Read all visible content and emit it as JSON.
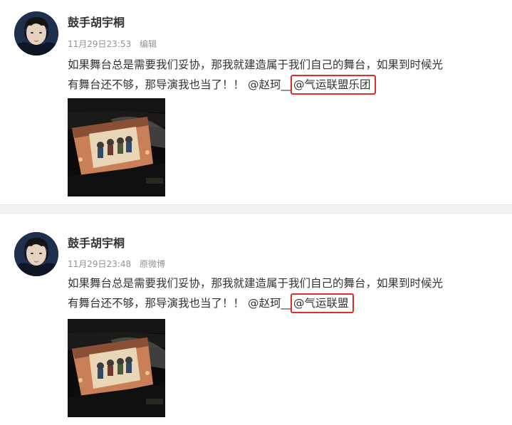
{
  "posts": [
    {
      "author": "鼓手胡宇桐",
      "timestamp": "11月29日23:53",
      "source": "编辑",
      "content": {
        "line1": "如果舞台总是需要我们妥协，那我就建造属于我们自己的舞台，如果到时候光",
        "line2": "有舞台还不够，那导演我也当了！！",
        "mention1": "@赵珂__",
        "mention2": "@气运联盟乐团"
      }
    },
    {
      "author": "鼓手胡宇桐",
      "timestamp": "11月29日23:48",
      "source": "原微博",
      "content": {
        "line1": "如果舞台总是需要我们妥协，那我就建造属于我们自己的舞台，如果到时候光",
        "line2": "有舞台还不够，那导演我也当了！！",
        "mention1": "@赵珂__",
        "mention2": "@气运联盟"
      }
    }
  ],
  "colors": {
    "highlight_box": "#e32b2b",
    "meta_text": "#939393",
    "divider_bg": "#f1f2f4"
  },
  "icons": {
    "avatar": "user-avatar-icon",
    "media": "video-thumbnail-icon"
  }
}
